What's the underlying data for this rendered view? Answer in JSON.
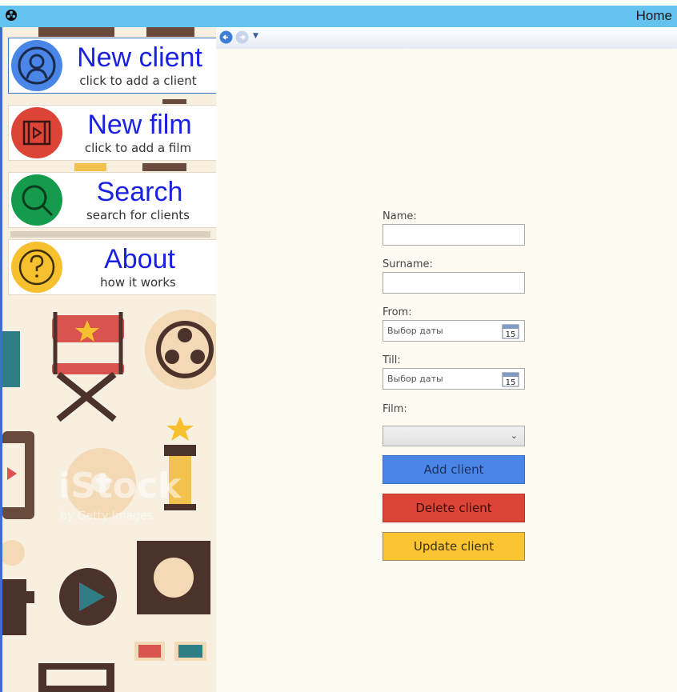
{
  "window": {
    "title": "Home",
    "icon": "film-reel-icon"
  },
  "navigation": {
    "back_icon": "back-arrow-icon",
    "forward_icon": "forward-arrow-icon",
    "dropdown_icon": "chevron-down-icon"
  },
  "sidebar": {
    "items": [
      {
        "title": "New client",
        "subtitle": "click to add a client",
        "icon": "user-icon",
        "color": "#4a86e8"
      },
      {
        "title": "New film",
        "subtitle": "click to add a film",
        "icon": "film-icon",
        "color": "#db4437"
      },
      {
        "title": "Search",
        "subtitle": "search for clients",
        "icon": "search-icon",
        "color": "#149c4c"
      },
      {
        "title": "About",
        "subtitle": "how it works",
        "icon": "question-icon",
        "color": "#f6c02e"
      }
    ],
    "watermark": "iStock",
    "watermark_sub": "by Getty Images"
  },
  "form": {
    "name_label": "Name:",
    "name_value": "",
    "surname_label": "Surname:",
    "surname_value": "",
    "from_label": "From:",
    "from_placeholder": "Выбор даты",
    "till_label": "Till:",
    "till_placeholder": "Выбор даты",
    "calendar_day": "15",
    "film_label": "Film:",
    "film_value": "",
    "add_label": "Add client",
    "delete_label": "Delete client",
    "update_label": "Update client"
  },
  "colors": {
    "titlebar": "#63c3ee",
    "add": "#4a86e8",
    "delete": "#db4437",
    "update": "#fbc531"
  }
}
